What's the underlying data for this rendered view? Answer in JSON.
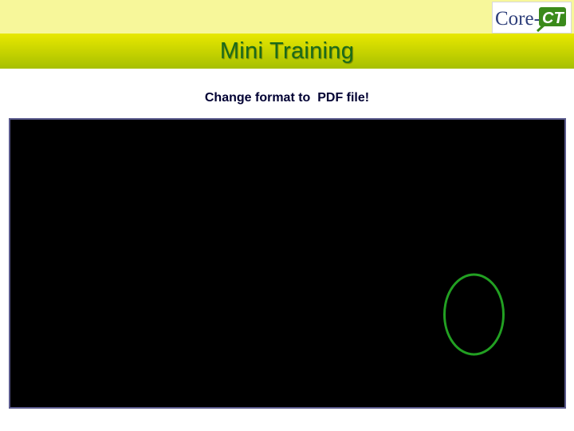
{
  "slide": {
    "title": "Mini Training",
    "subtitle": "Change format to  PDF file!",
    "logo": {
      "text_left": "Core-",
      "text_right": "CT"
    },
    "colors": {
      "top_band": "#f7f79a",
      "title_band": "#c8d400",
      "title_text": "#1a6a1a",
      "screen_background": "#000000",
      "highlight_circle": "#22a022"
    }
  }
}
